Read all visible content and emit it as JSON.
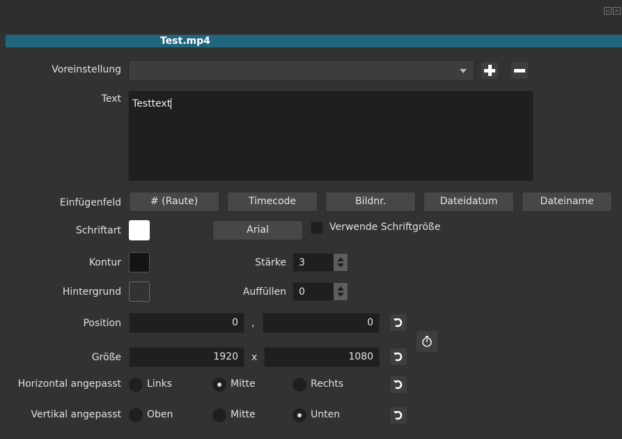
{
  "clip": {
    "title": "Test.mp4"
  },
  "preset": {
    "label": "Voreinstellung",
    "value": ""
  },
  "text": {
    "label": "Text",
    "value": "Testtext"
  },
  "insert_field": {
    "label": "Einfügenfeld",
    "buttons": [
      "# (Raute)",
      "Timecode",
      "Bildnr.",
      "Dateidatum",
      "Dateiname"
    ]
  },
  "font": {
    "label": "Schriftart",
    "color": "#ffffff",
    "name": "Arial",
    "use_font_size_label": "Verwende Schriftgröße"
  },
  "outline": {
    "label": "Kontur",
    "color": "#141414",
    "thickness_label": "Stärke",
    "thickness": "3"
  },
  "background": {
    "label": "Hintergrund",
    "color": "#323232",
    "padding_label": "Auffüllen",
    "padding": "0"
  },
  "position": {
    "label": "Position",
    "x": "0",
    "separator": ",",
    "y": "0"
  },
  "size": {
    "label": "Größe",
    "w": "1920",
    "separator": "x",
    "h": "1080"
  },
  "horizontal": {
    "label": "Horizontal angepasst",
    "options": [
      "Links",
      "Mitte",
      "Rechts"
    ],
    "selected": "Mitte"
  },
  "vertical": {
    "label": "Vertikal angepasst",
    "options": [
      "Oben",
      "Mitte",
      "Unten"
    ],
    "selected": "Unten"
  },
  "icons": {
    "add": "plus-icon",
    "remove": "minus-icon",
    "reset": "undo-icon",
    "keyframes": "stopwatch-icon",
    "dropdown": "chevron-down-icon"
  },
  "colors": {
    "accent": "#20667f",
    "panel": "#323232",
    "field": "#1f1f1f"
  }
}
